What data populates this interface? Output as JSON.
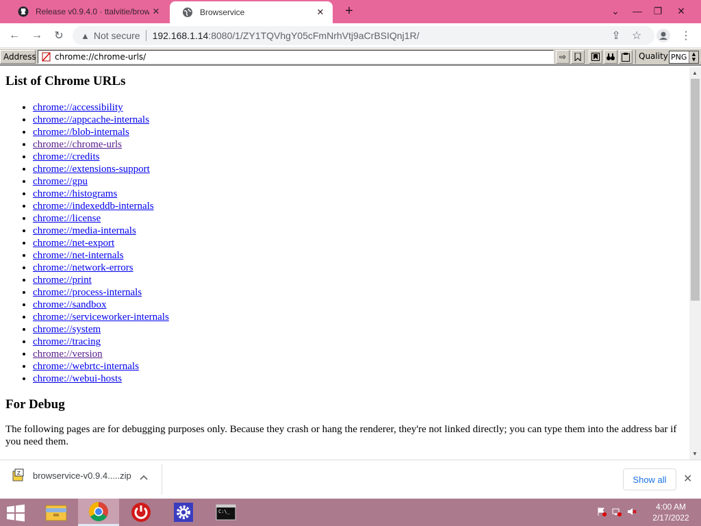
{
  "tabs": [
    {
      "title": "Release v0.9.4.0 · ttalvitie/brows",
      "icon": "github-icon",
      "close": "✕"
    },
    {
      "title": "Browservice",
      "icon": "globe-icon",
      "close": "✕"
    }
  ],
  "new_tab": "+",
  "window_controls": {
    "chevron": "⌄",
    "minimize": "—",
    "restore": "❐",
    "close": "✕"
  },
  "toolbar": {
    "back": "←",
    "forward": "→",
    "reload": "↻",
    "security_icon": "▲",
    "security_label": "Not secure",
    "url_host": "192.168.1.14",
    "url_rest": ":8080/1/ZY1TQVhgY05cFmNrhVtj9aCrBSIQnj1R/",
    "share": "⇪",
    "star": "☆",
    "menu": "⋮"
  },
  "browservice": {
    "address_label": "Address",
    "address_value": "chrome://chrome-urls/",
    "go": "⇨",
    "bookmark": "⊡",
    "find": "⌕",
    "quality_label": "Quality",
    "quality_value": "PNG"
  },
  "page": {
    "heading1": "List of Chrome URLs",
    "links": [
      "chrome://accessibility",
      "chrome://appcache-internals",
      "chrome://blob-internals",
      "chrome://chrome-urls",
      "chrome://credits",
      "chrome://extensions-support",
      "chrome://gpu",
      "chrome://histograms",
      "chrome://indexeddb-internals",
      "chrome://license",
      "chrome://media-internals",
      "chrome://net-export",
      "chrome://net-internals",
      "chrome://network-errors",
      "chrome://print",
      "chrome://process-internals",
      "chrome://sandbox",
      "chrome://serviceworker-internals",
      "chrome://system",
      "chrome://tracing",
      "chrome://version",
      "chrome://webrtc-internals",
      "chrome://webui-hosts"
    ],
    "heading2": "For Debug",
    "debug_text": "The following pages are for debugging purposes only. Because they crash or hang the renderer, they're not linked directly; you can type them into the address bar if you need them."
  },
  "download": {
    "filename": "browservice-v0.9.4.....zip",
    "show_all": "Show all"
  },
  "taskbar": {
    "time": "4:00 AM",
    "date": "2/17/2022"
  },
  "colors": {
    "tabstrip": "#e8679a",
    "taskbar": "#ab7a8d",
    "link": "#0000ee",
    "visited": "#551a8b"
  }
}
